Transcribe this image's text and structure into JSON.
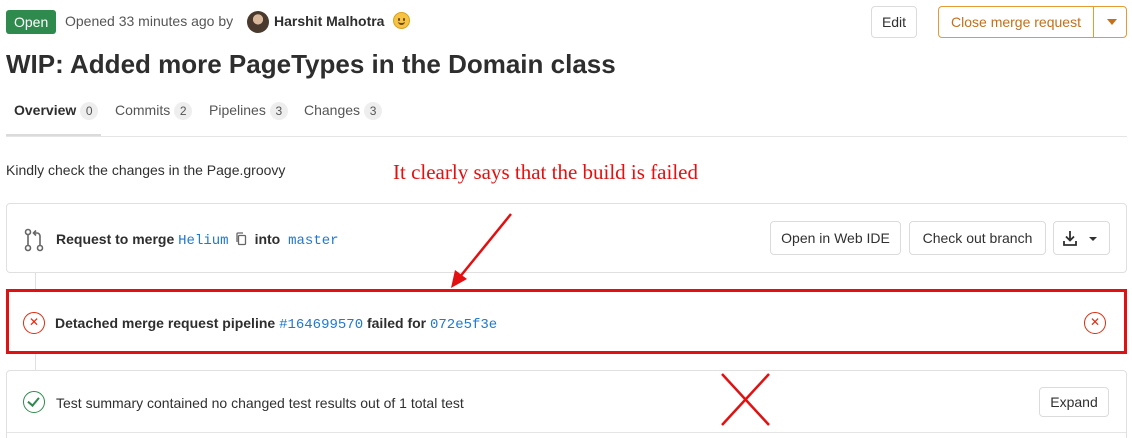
{
  "header": {
    "status": "Open",
    "opened_text": "Opened 33 minutes ago by",
    "author": "Harshit Malhotra",
    "edit_label": "Edit",
    "close_label": "Close merge request"
  },
  "title": "WIP: Added more PageTypes in the Domain class",
  "tabs": [
    {
      "label": "Overview",
      "count": "0"
    },
    {
      "label": "Commits",
      "count": "2"
    },
    {
      "label": "Pipelines",
      "count": "3"
    },
    {
      "label": "Changes",
      "count": "3"
    }
  ],
  "description": "Kindly check the changes in the Page.groovy",
  "annotation": "It clearly says that the build is failed",
  "merge": {
    "prefix": "Request to merge",
    "source_branch": "Helium",
    "into": "into",
    "target_branch": "master",
    "web_ide_label": "Open in Web IDE",
    "checkout_label": "Check out branch"
  },
  "pipeline": {
    "prefix": "Detached merge request pipeline",
    "id": "#164699570",
    "failed_for": "failed for",
    "commit": "072e5f3e"
  },
  "test_summary": {
    "text": "Test summary contained no changed test results out of 1 total test",
    "expand_label": "Expand"
  },
  "colors": {
    "annotation_red": "#e21010",
    "status_green": "#2f8a4e",
    "link_blue": "#1f78d1",
    "warning_orange": "#e39b34"
  }
}
